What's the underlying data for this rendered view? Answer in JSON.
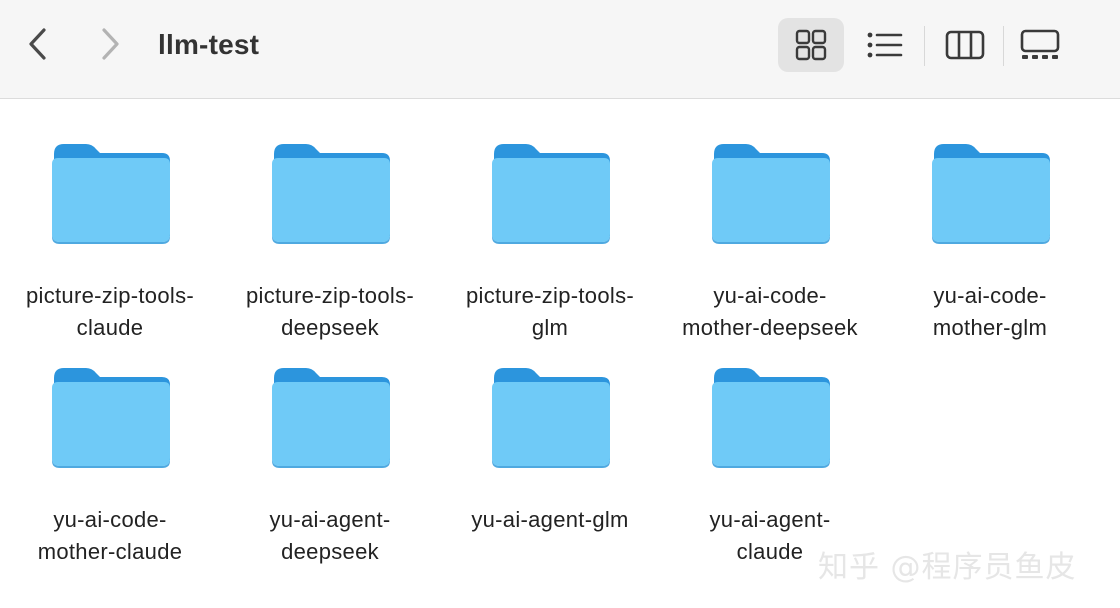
{
  "window": {
    "title": "llm-test"
  },
  "toolbar": {
    "back_icon": "chevron-left",
    "forward_icon": "chevron-right",
    "views": [
      {
        "name": "icon-view",
        "icon": "grid-2x2",
        "selected": true
      },
      {
        "name": "list-view",
        "icon": "list-bullets",
        "selected": false
      },
      {
        "name": "column-view",
        "icon": "columns-3",
        "selected": false
      },
      {
        "name": "gallery-view",
        "icon": "gallery",
        "selected": false
      }
    ]
  },
  "folders": [
    {
      "line1": "picture-zip-tools-",
      "line2": "claude"
    },
    {
      "line1": "picture-zip-tools-",
      "line2": "deepseek"
    },
    {
      "line1": "picture-zip-tools-",
      "line2": "glm"
    },
    {
      "line1": "yu-ai-code-",
      "line2": "mother-deepseek"
    },
    {
      "line1": "yu-ai-code-",
      "line2": "mother-glm"
    },
    {
      "line1": "yu-ai-code-",
      "line2": "mother-claude"
    },
    {
      "line1": "yu-ai-agent-",
      "line2": "deepseek"
    },
    {
      "line1": "yu-ai-agent-glm",
      "line2": ""
    },
    {
      "line1": "yu-ai-agent-",
      "line2": "claude"
    }
  ],
  "watermark": {
    "text": "知乎 @程序员鱼皮"
  },
  "colors": {
    "folder_back": "#2c95dd",
    "folder_front": "#6fcaf7",
    "toolbar_bg": "#f6f6f6",
    "selected_view_bg": "#e3e3e3"
  }
}
